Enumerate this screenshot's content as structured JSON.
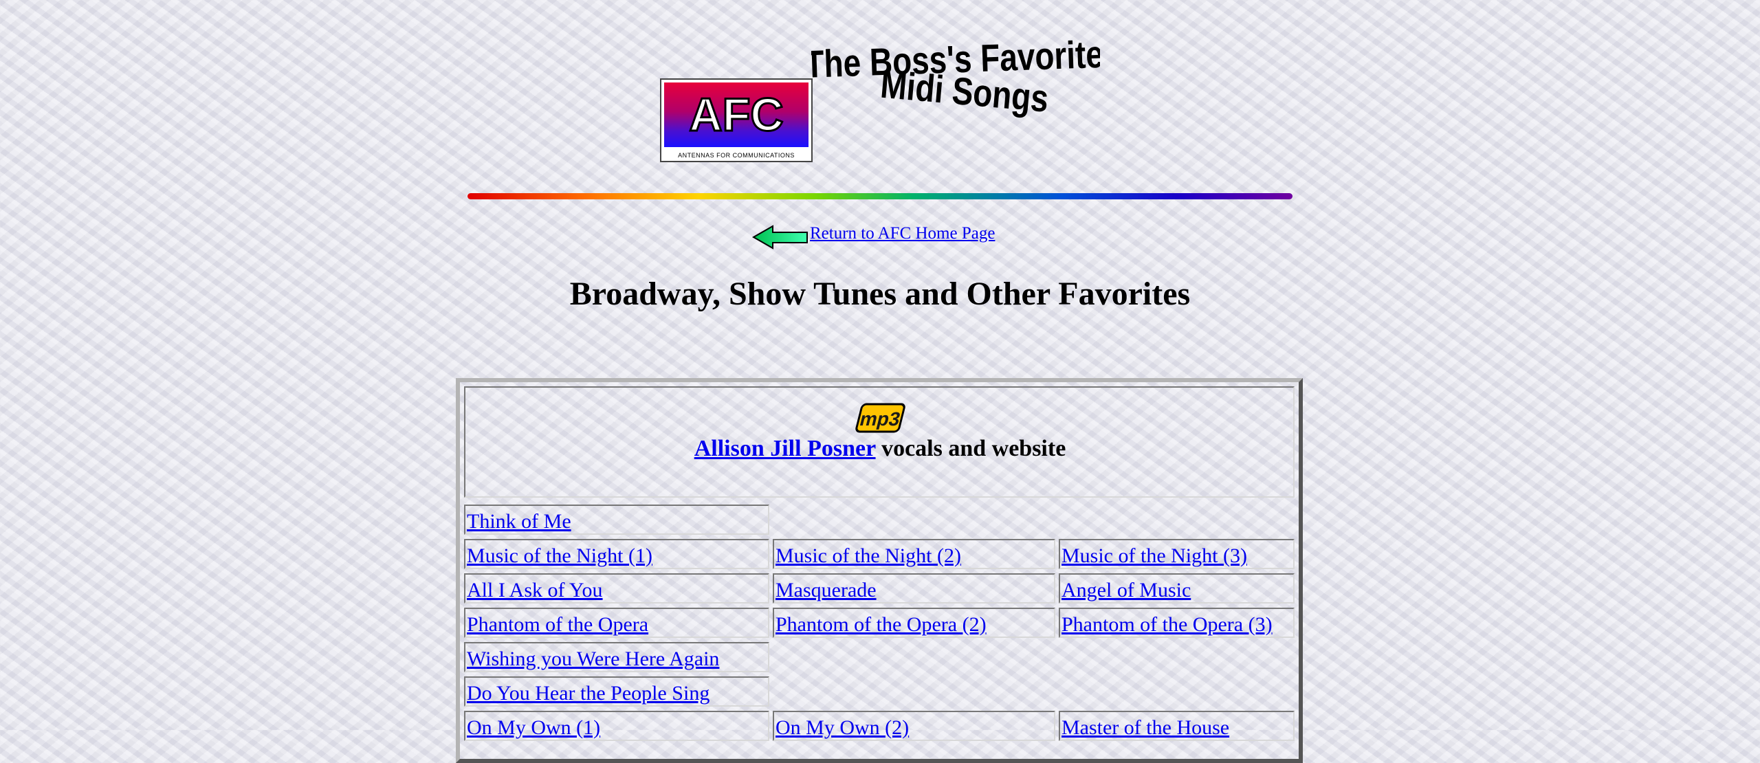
{
  "header": {
    "logo_text": "AFC",
    "logo_caption": "ANTENNAS FOR COMMUNICATIONS",
    "title_line1": "The Boss's Favorite",
    "title_line2": "Midi Songs"
  },
  "nav": {
    "return_label": "Return to AFC Home Page"
  },
  "page": {
    "heading": "Broadway, Show Tunes and Other Favorites"
  },
  "table": {
    "mp3_badge": "mp3",
    "artist_link": "Allison Jill Posner",
    "artist_suffix": " vocals and website",
    "rows": [
      [
        "Think of Me"
      ],
      [
        "Music of the Night (1)",
        "Music of the Night (2)",
        "Music of the Night (3)"
      ],
      [
        "All I Ask of You",
        "Masquerade",
        "Angel of Music"
      ],
      [
        "Phantom of the Opera",
        "Phantom of the Opera (2)",
        "Phantom of the Opera (3)"
      ],
      [
        "Wishing you Were Here Again"
      ],
      [
        "Do You Hear the People Sing"
      ],
      [
        "On My Own (1)",
        "On My Own (2)",
        "Master of the House"
      ]
    ]
  },
  "colors": {
    "link": "#0000ee",
    "background": "#e6e6ee"
  }
}
